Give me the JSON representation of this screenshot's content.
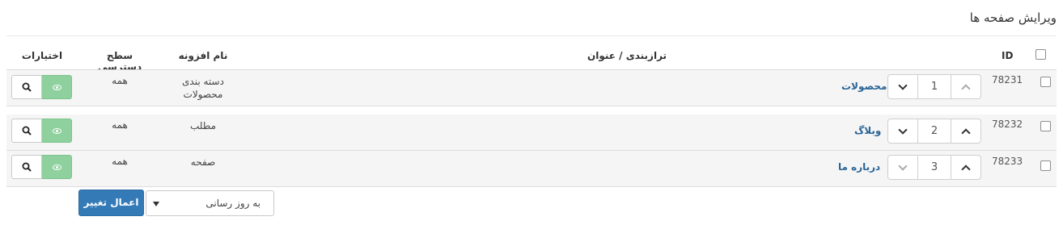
{
  "page": {
    "title": "ویرایش صفحه ها"
  },
  "table": {
    "headers": {
      "id": "ID",
      "order_title": "ترازبندی / عنوان",
      "extension": "نام افزونه",
      "access": "سطح دسترسی",
      "options": "اختیارات"
    },
    "rows": [
      {
        "id": "78231",
        "order": "1",
        "title": "محصولات",
        "extension": "دسته بندی محصولات",
        "access": "همه"
      },
      {
        "id": "78232",
        "order": "2",
        "title": "وبلاگ",
        "extension": "مطلب",
        "access": "همه"
      },
      {
        "id": "78233",
        "order": "3",
        "title": "درباره ما",
        "extension": "صفحه",
        "access": "همه"
      }
    ]
  },
  "footer": {
    "bulk_action_selected": "به روز رسانی",
    "apply_label": "اعمال تغییر"
  },
  "colors": {
    "link": "#2a6496",
    "primary_button": "#337ab7",
    "view_button": "#8fd19e",
    "row_background": "#f5f5f5"
  },
  "icons": [
    "chevron-up-icon",
    "chevron-down-icon",
    "search-icon",
    "eye-icon",
    "caret-down-icon"
  ]
}
